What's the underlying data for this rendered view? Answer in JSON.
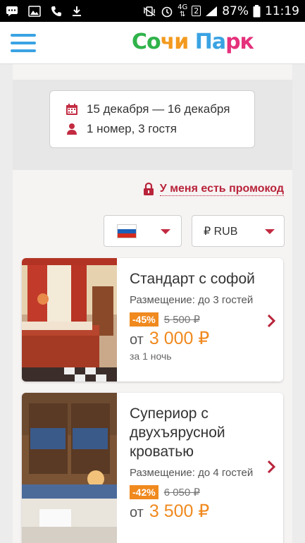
{
  "statusbar": {
    "network": "4G",
    "sim": "2",
    "battery": "87%",
    "time": "11:19"
  },
  "header": {
    "menu_icon": "hamburger-icon",
    "logo_parts": [
      "Со",
      "чи",
      " Па",
      "рк"
    ],
    "logo_colors": [
      "#2fb34a",
      "#f39a1e",
      "#3aa3e3",
      "#e5317c"
    ]
  },
  "search": {
    "dates": "15 декабря — 16 декабря",
    "guests": "1 номер, 3 гостя",
    "calendar_icon": "calendar-icon",
    "person_icon": "person-icon"
  },
  "promo": {
    "label": "У меня есть промокод",
    "icon": "lock-icon"
  },
  "filters": {
    "language_flag": "russia-flag",
    "currency": "₽ RUB"
  },
  "colors": {
    "accent": "#b8243a",
    "price": "#f0891e",
    "menu": "#3aa3e3"
  },
  "rooms": [
    {
      "title": "Стандарт с софой",
      "occupancy": "Размещение: до 3 гостей",
      "discount": "-45%",
      "old_price": "5 500 ₽",
      "from": "от",
      "price": "3 000 ₽",
      "per_night": "за 1 ночь"
    },
    {
      "title": "Супериор с двухъярусной кроватью",
      "occupancy": "Размещение: до 4 гостей",
      "discount": "-42%",
      "old_price": "6 050 ₽",
      "from": "от",
      "price": "3 500 ₽",
      "per_night": ""
    }
  ]
}
